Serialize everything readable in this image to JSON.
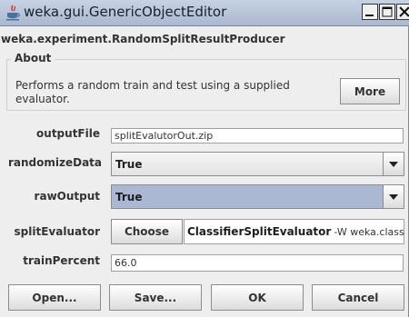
{
  "window": {
    "title": "weka.gui.GenericObjectEditor",
    "icons": {
      "app": "java-cup-icon",
      "minimize": "minimize-icon",
      "maximize": "maximize-icon",
      "close": "close-icon"
    }
  },
  "editor": {
    "class_name": "weka.experiment.RandomSplitResultProducer",
    "about": {
      "label": "About",
      "description": "Performs a random train and test using a supplied evaluator.",
      "more_label": "More"
    }
  },
  "properties": {
    "output_file": {
      "label": "outputFile",
      "value": "splitEvalutorOut.zip"
    },
    "randomize_data": {
      "label": "randomizeData",
      "value": "True"
    },
    "raw_output": {
      "label": "rawOutput",
      "value": "True"
    },
    "split_evaluator": {
      "label": "splitEvaluator",
      "choose_label": "Choose",
      "class_name": "ClassifierSplitEvaluator",
      "options": "-W weka.classifi"
    },
    "train_percent": {
      "label": "trainPercent",
      "value": "66.0"
    }
  },
  "buttons": {
    "open": "Open...",
    "save": "Save...",
    "ok": "OK",
    "cancel": "Cancel"
  }
}
